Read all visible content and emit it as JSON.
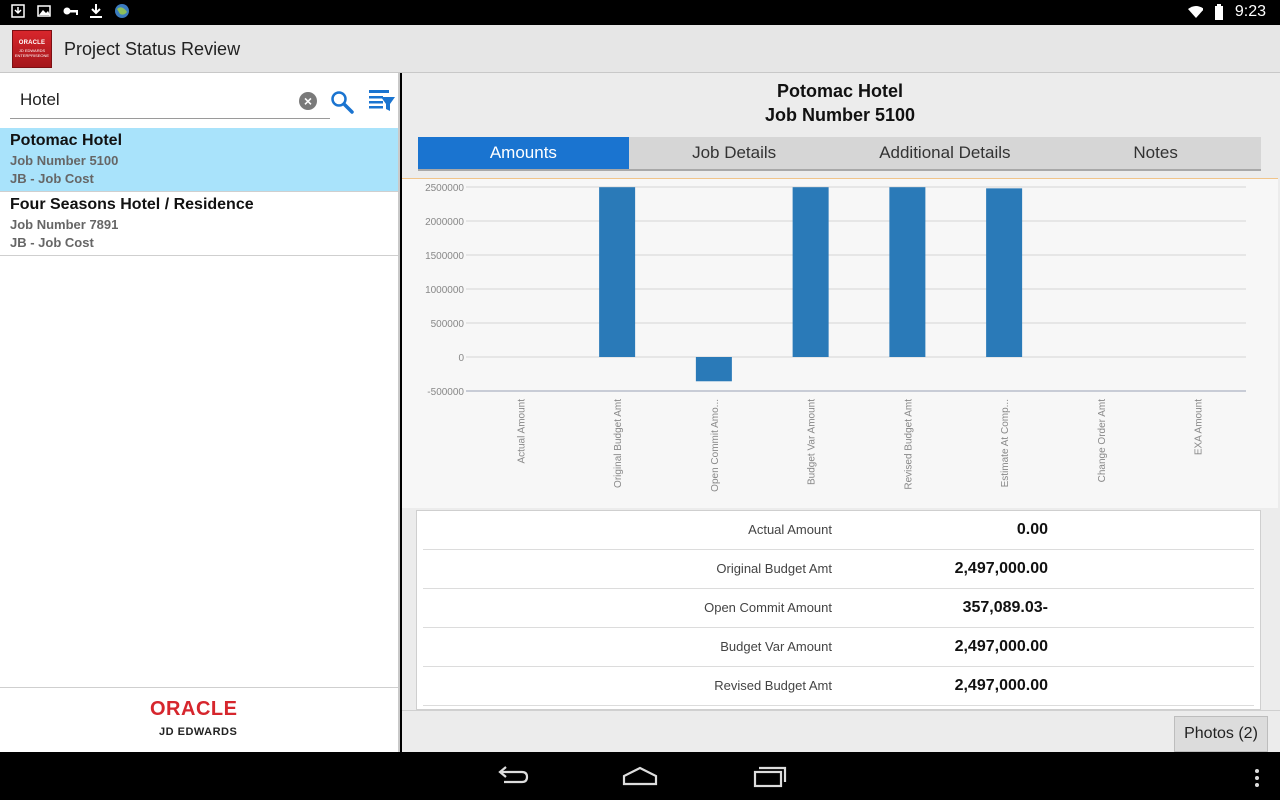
{
  "status_bar": {
    "time": "9:23"
  },
  "app": {
    "title": "Project Status Review",
    "logo_text": "ORACLE",
    "logo_sub": "JD EDWARDS ENTERPRISEONE"
  },
  "search": {
    "value": "Hotel"
  },
  "list": [
    {
      "name": "Potomac Hotel",
      "job": "Job Number 5100",
      "type": "JB - Job Cost",
      "selected": true
    },
    {
      "name": "Four Seasons Hotel / Residence",
      "job": "Job Number 7891",
      "type": "JB - Job Cost",
      "selected": false
    }
  ],
  "footer": {
    "brand": "ORACLE",
    "product": "JD EDWARDS",
    "brand_color": "#d6262d"
  },
  "detail": {
    "title": "Potomac Hotel",
    "subtitle": "Job Number 5100",
    "tabs": [
      {
        "label": "Amounts",
        "active": true
      },
      {
        "label": "Job Details",
        "active": false
      },
      {
        "label": "Additional Details",
        "active": false
      },
      {
        "label": "Notes",
        "active": false
      }
    ],
    "amounts": [
      {
        "label": "Actual Amount",
        "value": "0.00"
      },
      {
        "label": "Original Budget Amt",
        "value": "2,497,000.00"
      },
      {
        "label": "Open Commit Amount",
        "value": "357,089.03-"
      },
      {
        "label": "Budget Var Amount",
        "value": "2,497,000.00"
      },
      {
        "label": "Revised Budget Amt",
        "value": "2,497,000.00"
      }
    ],
    "photos_button": "Photos (2)"
  },
  "chart_data": {
    "type": "bar",
    "categories": [
      "Actual Amount",
      "Original Budget Amt",
      "Open Commit Amo...",
      "Budget Var Amount",
      "Revised Budget Amt",
      "Estimate At Comp...",
      "Change Order Amt",
      "EXA Amount"
    ],
    "values": [
      0,
      2497000,
      -357089.03,
      2497000,
      2497000,
      2480000,
      0,
      0
    ],
    "ylim": [
      -500000,
      2500000
    ],
    "yticks": [
      "2500000",
      "2000000",
      "1500000",
      "1000000",
      "500000",
      "0",
      "-500000"
    ],
    "ytick_values": [
      2500000,
      2000000,
      1500000,
      1000000,
      500000,
      0,
      -500000
    ],
    "bar_color": "#2a7ab8",
    "grid": true
  },
  "accent_color": "#1a74d0",
  "selected_color": "#a9e3fb"
}
